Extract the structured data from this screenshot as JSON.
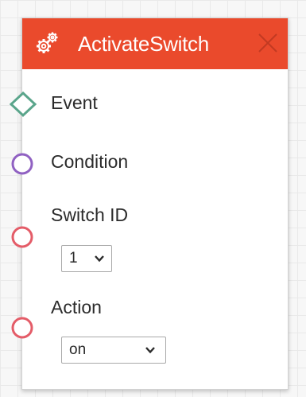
{
  "node": {
    "title": "ActivateSwitch",
    "header_color": "#ea4a2c",
    "header_icon": "gears-icon",
    "close_icon": "close-icon"
  },
  "ports": {
    "event": {
      "label": "Event",
      "color": "#5aa58b",
      "shape": "diamond"
    },
    "condition": {
      "label": "Condition",
      "color": "#9061c2",
      "shape": "circle"
    },
    "switch_id": {
      "label": "Switch ID",
      "color": "#e45c68",
      "shape": "circle",
      "selected": "1"
    },
    "action": {
      "label": "Action",
      "color": "#e45c68",
      "shape": "circle",
      "selected": "on"
    }
  }
}
